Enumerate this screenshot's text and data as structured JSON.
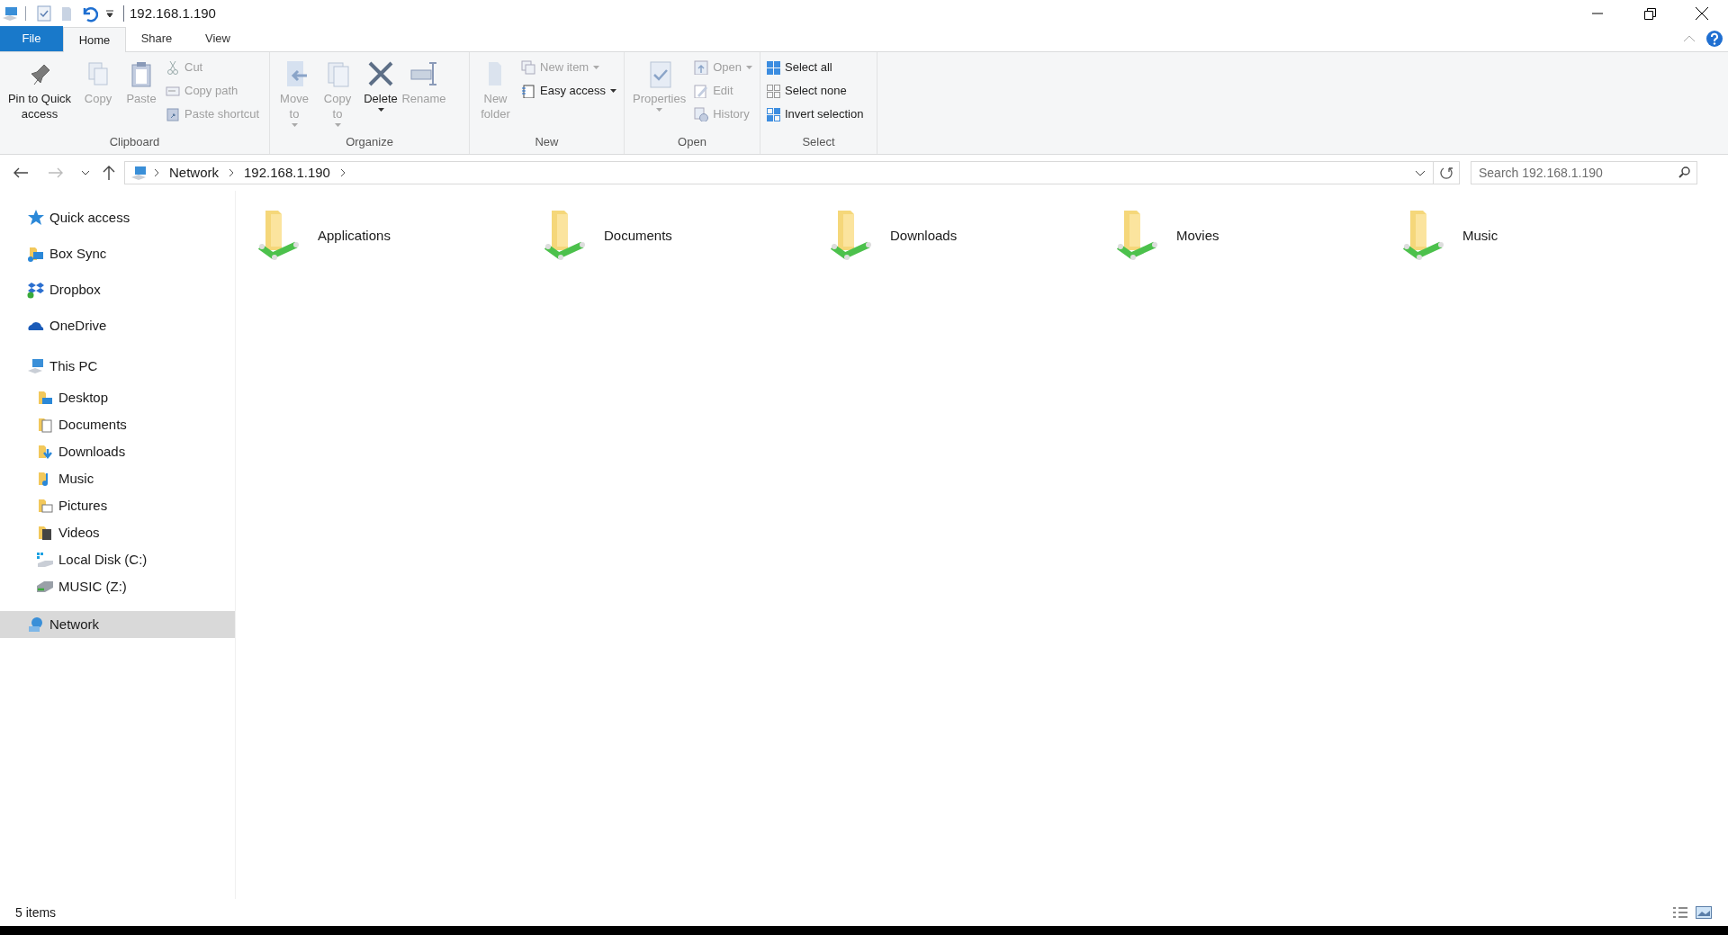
{
  "window": {
    "title": "192.168.1.190"
  },
  "tabs": [
    {
      "label": "File",
      "kind": "file",
      "selected": false
    },
    {
      "label": "Home",
      "kind": "tab",
      "selected": true
    },
    {
      "label": "Share",
      "kind": "tab",
      "selected": false
    },
    {
      "label": "View",
      "kind": "tab",
      "selected": false
    }
  ],
  "ribbon": [
    {
      "label": "Clipboard",
      "items": [
        {
          "kind": "large",
          "label": "Pin to Quick access",
          "disabled": false,
          "dropdown": false
        },
        {
          "kind": "large",
          "label": "Copy",
          "disabled": true,
          "dropdown": false
        },
        {
          "kind": "large",
          "label": "Paste",
          "disabled": true,
          "dropdown": false
        },
        {
          "kind": "small",
          "label": "Cut",
          "disabled": true,
          "dropdown": false
        },
        {
          "kind": "small",
          "label": "Copy path",
          "disabled": true,
          "dropdown": false
        },
        {
          "kind": "small",
          "label": "Paste shortcut",
          "disabled": true,
          "dropdown": false
        }
      ]
    },
    {
      "label": "Organize",
      "items": [
        {
          "kind": "large",
          "label": "Move to",
          "disabled": true,
          "dropdown": true
        },
        {
          "kind": "large",
          "label": "Copy to",
          "disabled": true,
          "dropdown": true
        },
        {
          "kind": "large",
          "label": "Delete",
          "disabled": false,
          "dropdown": true
        },
        {
          "kind": "large",
          "label": "Rename",
          "disabled": true,
          "dropdown": false
        }
      ]
    },
    {
      "label": "New",
      "items": [
        {
          "kind": "large",
          "label": "New folder",
          "disabled": true,
          "dropdown": false
        },
        {
          "kind": "small",
          "label": "New item",
          "disabled": true,
          "dropdown": true
        },
        {
          "kind": "small",
          "label": "Easy access",
          "disabled": false,
          "dropdown": true
        }
      ]
    },
    {
      "label": "Open",
      "items": [
        {
          "kind": "large",
          "label": "Properties",
          "disabled": true,
          "dropdown": true
        },
        {
          "kind": "small",
          "label": "Open",
          "disabled": true,
          "dropdown": true
        },
        {
          "kind": "small",
          "label": "Edit",
          "disabled": true,
          "dropdown": false
        },
        {
          "kind": "small",
          "label": "History",
          "disabled": true,
          "dropdown": false
        }
      ]
    },
    {
      "label": "Select",
      "items": [
        {
          "kind": "small",
          "label": "Select all",
          "disabled": false,
          "dropdown": false
        },
        {
          "kind": "small",
          "label": "Select none",
          "disabled": false,
          "dropdown": false
        },
        {
          "kind": "small",
          "label": "Invert selection",
          "disabled": false,
          "dropdown": false
        }
      ]
    }
  ],
  "address_bar": {
    "breadcrumbs": [
      "Network",
      "192.168.1.190"
    ]
  },
  "search": {
    "placeholder": "Search 192.168.1.190"
  },
  "sidebar": {
    "items": [
      {
        "label": "Quick access",
        "selected": false
      },
      {
        "label": "Box Sync",
        "selected": false
      },
      {
        "label": "Dropbox",
        "selected": false
      },
      {
        "label": "OneDrive",
        "selected": false
      },
      {
        "label": "This PC",
        "selected": false,
        "children": [
          {
            "label": "Desktop",
            "selected": false
          },
          {
            "label": "Documents",
            "selected": false
          },
          {
            "label": "Downloads",
            "selected": false
          },
          {
            "label": "Music",
            "selected": false
          },
          {
            "label": "Pictures",
            "selected": false
          },
          {
            "label": "Videos",
            "selected": false
          },
          {
            "label": "Local Disk (C:)",
            "selected": false
          },
          {
            "label": "MUSIC (Z:)",
            "selected": false
          }
        ]
      },
      {
        "label": "Network",
        "selected": true
      }
    ]
  },
  "folders": [
    {
      "name": "Applications",
      "selected": false
    },
    {
      "name": "Documents",
      "selected": false
    },
    {
      "name": "Downloads",
      "selected": false
    },
    {
      "name": "Movies",
      "selected": false
    },
    {
      "name": "Music",
      "selected": false
    }
  ],
  "status_bar": {
    "item_count": "5 items"
  }
}
